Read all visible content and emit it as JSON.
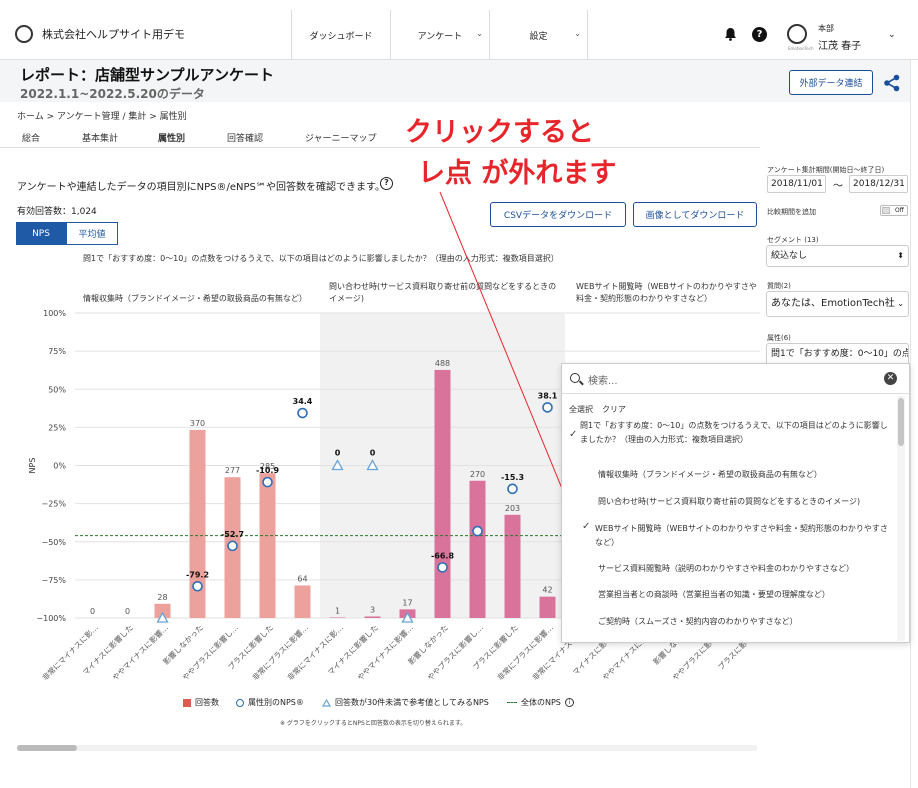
{
  "header": {
    "company": "株式会社ヘルプサイト用デモ",
    "nav": [
      {
        "label": "ダッシュボード",
        "chev": ""
      },
      {
        "label": "アンケート",
        "chev": "⌄"
      },
      {
        "label": "設定",
        "chev": "⌄"
      }
    ],
    "avatar_label": "EmotionTech",
    "user_dept": "本部",
    "user_name": "江茂 春子",
    "user_chev": "⌄"
  },
  "titlebar": {
    "title": "レポート：店舗型サンプルアンケート",
    "subtitle": "2022.1.1~2022.5.20のデータ",
    "external_button": "外部データ連結"
  },
  "breadcrumb": "ホーム > アンケート管理 / 集計 > 属性別",
  "tabs": [
    "総合",
    "基本集計",
    "属性別",
    "回答確認",
    "ジャーニーマップ"
  ],
  "callout": {
    "line1": "クリックすると",
    "line2": "レ点 が外れます"
  },
  "main": {
    "description": "アンケートや連結したデータの項目別にNPS®/eNPS℠や回答数を確認できます。",
    "help": "?",
    "count": "有効回答数：1,024",
    "csv_button": "CSVデータをダウンロード",
    "image_button": "画像としてダウンロード",
    "toggle_nps": "NPS",
    "toggle_avg": "平均値",
    "question_title": "問1で「おすすめ度：0〜10」の点数をつけるうえで、以下の項目はどのように影響しましたか？（理由の入力形式：複数項目選択）",
    "col1": "情報収集時（ブランドイメージ・希望の取扱商品の有無など）",
    "col2": "問い合わせ時(サービス資料取り寄せ前の質問などをするときのイメージ)",
    "col3": "WEBサイト閲覧時（WEBサイトのわかりやすさや料金・契約形態のわかりやすさなど）",
    "legend_count": "回答数",
    "legend_nps": "属性別のNPS®",
    "legend_ref": "回答数が30件未満で参考値としてみるNPS",
    "legend_total": "全体のNPS",
    "note": "※ グラフをクリックするとNPSと回答数の表示を切り替えられます。"
  },
  "chart_data": {
    "type": "bar",
    "ylabel": "NPS",
    "yticks": [
      "100%",
      "75%",
      "50%",
      "25%",
      "0%",
      "−25%",
      "−50%",
      "−75%",
      "−100%"
    ],
    "ylim": [
      -100,
      100
    ],
    "total_nps": -46,
    "categories": [
      "非常にマイナスに影…",
      "マイナスに影響した",
      "ややマイナスに影響…",
      "影響しなかった",
      "ややプラスに影響し…",
      "プラスに影響した",
      "非常にプラスに影響…",
      "非常にマイナスに影…",
      "マイナスに影響した",
      "ややマイナスに影響…",
      "影響しなかった",
      "ややプラスに影響し…",
      "プラスに影響した",
      "非常にプラスに影響…",
      "非常にマイナスに影…",
      "マイナスに影響した",
      "ややマイナスに影響…",
      "影響しなかった",
      "ややプラスに影響し…",
      "プラスに影響した",
      "非常に…"
    ],
    "counts": [
      "0",
      "0",
      "28",
      "370",
      "277",
      "285",
      "64",
      "1",
      "3",
      "17",
      "488",
      "270",
      "203",
      "42"
    ],
    "count_values": [
      0,
      0,
      28,
      370,
      277,
      285,
      64,
      1,
      3,
      17,
      488,
      270,
      203,
      42
    ],
    "nps_values": [
      null,
      null,
      -100,
      -79.2,
      -52.7,
      -10.9,
      34.4,
      0,
      0,
      -100,
      -66.8,
      -43,
      -15.3,
      38.1
    ],
    "nps_labels": [
      "",
      "",
      "",
      "-79.2",
      "-52.7",
      "-10.9",
      "34.4",
      "0",
      "0",
      "",
      "-66.8",
      "",
      "-15.3",
      "38.1"
    ],
    "reference": [
      false,
      false,
      true,
      false,
      false,
      false,
      false,
      true,
      true,
      true,
      false,
      false,
      false,
      false
    ],
    "colors": {
      "group1": "#eda19c",
      "group2": "#d9739c",
      "total": "#2a7a2a",
      "nps": "#2f6fb5"
    }
  },
  "sidebar": {
    "period_label": "アンケート集計期間(開始日〜終了日)",
    "start": "2018/11/01",
    "tilde": "〜",
    "end": "2018/12/31",
    "compare_label": "比較期間を追加",
    "compare_state": "Off",
    "segment_label": "セグメント (13)",
    "segment_value": "絞込なし",
    "question_label": "質問(2)",
    "question_value": "あなたは、EmotionTech社",
    "attr_label": "属性(6)",
    "attr_value": "問1で「おすすめ度：0〜10」の点"
  },
  "dropdown": {
    "placeholder": "検索...",
    "select_all": "全選択",
    "clear": "クリア",
    "items": [
      "問1で「おすすめ度：0〜10」の点数をつけるうえで、以下の項目はどのように影響しましたか？（理由の入力形式：複数項目選択）",
      "情報収集時（ブランドイメージ・希望の取扱商品の有無など）",
      "問い合わせ時(サービス資料取り寄せ前の質問などをするときのイメージ)",
      "WEBサイト閲覧時（WEBサイトのわかりやすさや料金・契約形態のわかりやすさなど）",
      "サービス資料閲覧時（説明のわかりやすさや料金のわかりやすさなど）",
      "営業担当者との商談時（営業担当者の知識・要望の理解度など）",
      "ご契約時（スムーズさ・契約内容のわかりやすさなど）"
    ]
  }
}
